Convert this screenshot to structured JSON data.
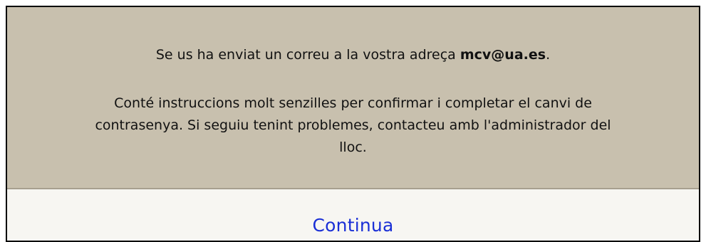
{
  "message": {
    "sent_prefix": "Se us ha enviat un correu a la vostra adreça ",
    "email": "mcv@ua.es",
    "sent_suffix": ".",
    "instructions": "Conté instruccions molt senzilles per confirmar i completar el canvi de contrasenya. Si seguiu tenint problemes, contacteu amb l'administrador del lloc."
  },
  "actions": {
    "continue_label": "Continua"
  },
  "colors": {
    "panel_background": "#c8c0ae",
    "page_background": "#f7f6f2",
    "link": "#1a2fd6"
  }
}
